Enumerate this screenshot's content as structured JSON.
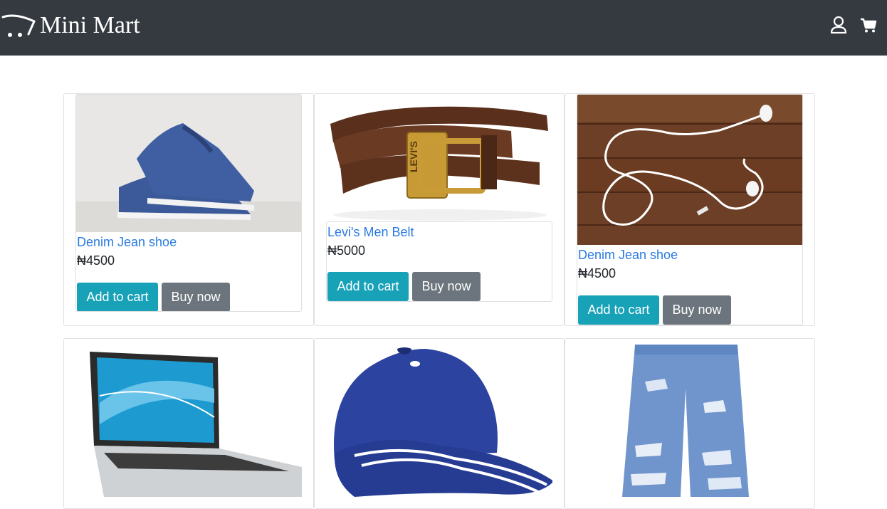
{
  "brand": {
    "name": "Mini Mart"
  },
  "navbar": {
    "user_icon": "user-icon",
    "cart_icon": "shopping-cart-icon"
  },
  "products": [
    {
      "name": "Denim Jean shoe",
      "price": "₦4500",
      "add_label": "Add to cart",
      "buy_label": "Buy now",
      "image": "blue-canvas-shoe"
    },
    {
      "name": "Levi's Men Belt",
      "price": "₦5000",
      "add_label": "Add to cart",
      "buy_label": "Buy now",
      "image": "brown-leather-belt"
    },
    {
      "name": "Denim Jean shoe",
      "price": "₦4500",
      "add_label": "Add to cart",
      "buy_label": "Buy now",
      "image": "white-earphones"
    },
    {
      "name": "",
      "price": "",
      "image": "laptop"
    },
    {
      "name": "",
      "price": "",
      "image": "blue-cap"
    },
    {
      "name": "",
      "price": "",
      "image": "ripped-jeans"
    }
  ],
  "colors": {
    "navbar": "#343a40",
    "primary_btn": "#17a2b8",
    "secondary_btn": "#6c757d",
    "link": "#2a7ae2"
  }
}
